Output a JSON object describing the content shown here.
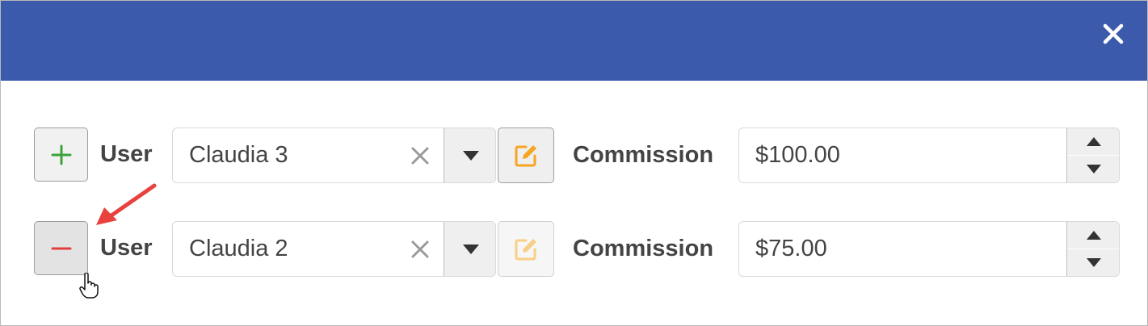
{
  "dialog": {
    "close_icon": "close-icon",
    "header_color": "#3b5aab"
  },
  "rows": [
    {
      "action_icon": "plus-icon",
      "action_color": "#3aa33a",
      "user_label": "User",
      "user_value": "Claudia 3",
      "commission_label": "Commission",
      "commission_value": "$100.00",
      "edit_enabled": true
    },
    {
      "action_icon": "minus-icon",
      "action_color": "#e0413f",
      "user_label": "User",
      "user_value": "Claudia 2",
      "commission_label": "Commission",
      "commission_value": "$75.00",
      "edit_enabled": false
    }
  ],
  "colors": {
    "accent_edit": "#f5a623",
    "annotation_arrow": "#e8413e"
  }
}
